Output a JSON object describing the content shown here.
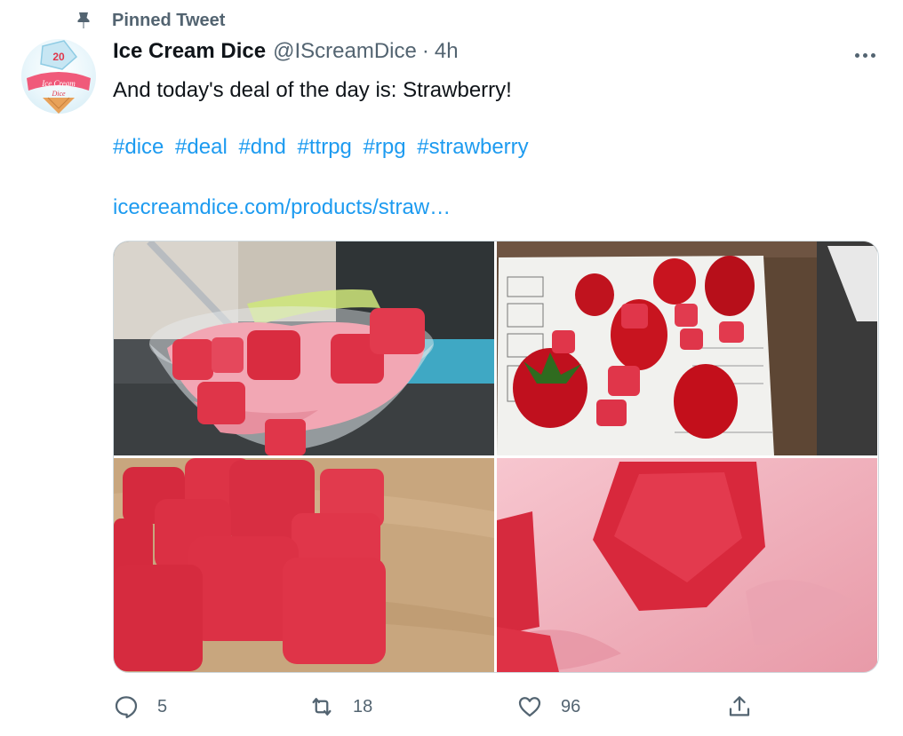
{
  "pinned": {
    "label": "Pinned Tweet",
    "icon": "pin-icon"
  },
  "author": {
    "name": "Ice Cream Dice",
    "handle": "@IScreamDice",
    "separator": "·",
    "time": "4h",
    "avatar_text": {
      "number": "20",
      "line1": "Ice Cream",
      "line2": "Dice"
    }
  },
  "tweet": {
    "text": "And today's deal of the day is: Strawberry!",
    "hashtags": [
      "#dice",
      "#deal",
      "#dnd",
      "#ttrpg",
      "#rpg",
      "#strawberry"
    ],
    "link": "icecreamdice.com/products/straw…"
  },
  "actions": {
    "reply": {
      "icon": "reply-icon",
      "count": "5"
    },
    "retweet": {
      "icon": "retweet-icon",
      "count": "18"
    },
    "like": {
      "icon": "like-icon",
      "count": "96"
    },
    "share": {
      "icon": "share-icon"
    }
  },
  "colors": {
    "text": "#0f1419",
    "secondary": "#536471",
    "link": "#1d9bf0",
    "border": "#cfd9de",
    "dice_red": "#e0364a",
    "ice_cream_pink": "#f2a7b4"
  }
}
